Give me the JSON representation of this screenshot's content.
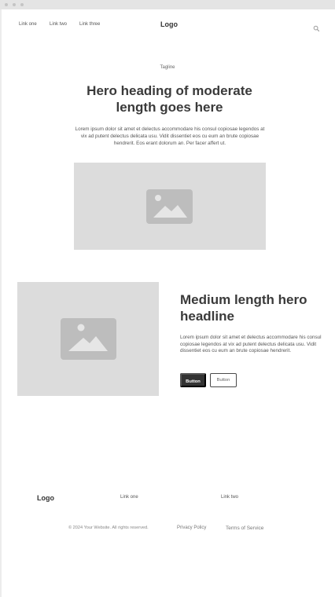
{
  "nav": {
    "links": [
      "Link one",
      "Link two",
      "Link three"
    ],
    "logo": "Logo",
    "search_icon": "search-icon"
  },
  "hero": {
    "tagline": "Tagline",
    "heading": "Hero heading of moderate length goes here",
    "body": "Lorem ipsum dolor sit amet et delectus accommodare his consul copiosae legendos at vix ad putent delectus delicata usu. Vidit dissentiet eos cu eum an brute copiosae hendrerit. Eos erant dolorum an. Per facer affert ut.",
    "image_icon": "image-placeholder-icon"
  },
  "feature": {
    "heading": "Medium length hero headline",
    "body": "Lorem ipsum dolor sit amet et delectus accommodare his consul copiosae legendos at vix ad putent delectus delicata usu. Vidit dissentiet eos cu eum an brute copiosae hendrerit.",
    "primary_button": "Button",
    "secondary_button": "Button",
    "image_icon": "image-placeholder-icon"
  },
  "footer": {
    "logo": "Logo",
    "links": [
      "Link one",
      "Link two"
    ],
    "copyright": "© 2024 Your Website. All rights reserved.",
    "privacy": "Privacy Policy",
    "terms": "Terms of Service"
  },
  "colors": {
    "placeholder_bg": "#dcdcdc",
    "placeholder_icon": "#bdbdbd",
    "dark_button": "#333333",
    "text": "#3c3c3c"
  }
}
